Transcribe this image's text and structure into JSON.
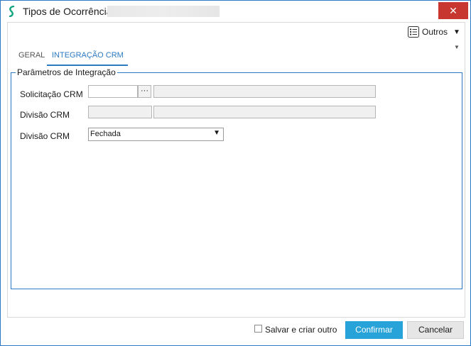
{
  "window": {
    "title": "Tipos de Ocorrência"
  },
  "toolbar": {
    "outros_label": "Outros"
  },
  "tabs": [
    {
      "label": "GERAL"
    },
    {
      "label": "INTEGRAÇÃO CRM"
    }
  ],
  "group": {
    "legend": "Parâmetros de Integração",
    "rows": [
      {
        "label": "Solicitação CRM",
        "code": "",
        "description": ""
      },
      {
        "label": "Divisão CRM",
        "code": "",
        "description": ""
      },
      {
        "label": "Divisão CRM",
        "selected": "Fechada"
      }
    ]
  },
  "footer": {
    "checkbox_label": "Salvar e criar outro",
    "confirm_label": "Confirmar",
    "cancel_label": "Cancelar"
  },
  "colors": {
    "accent": "#2b79c2",
    "confirm": "#27a3d9",
    "close": "#c7372f"
  }
}
